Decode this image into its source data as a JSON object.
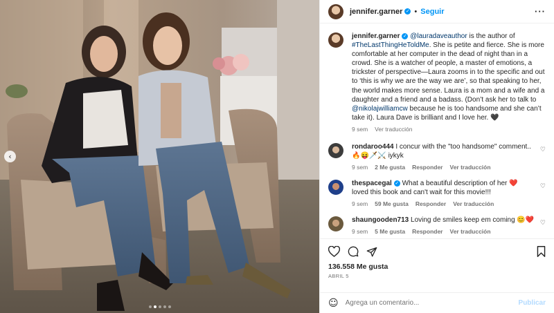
{
  "header": {
    "username": "jennifer.garner",
    "separator": "•",
    "follow_label": "Seguir",
    "more_icon": "more-horizontal-icon"
  },
  "caption": {
    "username": "jennifer.garner",
    "mention": "@lauradaveauthor",
    "text1": " is the author of ",
    "hashtag": "#TheLastThingHeToldMe",
    "text2": ". She is petite and fierce. She is more comfortable at her computer in the dead of night than in a crowd. She is a watcher of people, a master of emotions, a trickster of perspective—Laura zooms in to the specific and out to ‘this is why we are the way we are’, so that speaking to her, the world makes more sense. Laura is a mom and a wife and a daughter and a friend and a badass. (Don’t ask her to talk to ",
    "mention2": "@nikolajwilliamcw",
    "text3": " because he is too handsome and she can’t take it). Laura Dave is brilliant and I love her. 🖤",
    "time": "9 sem",
    "translate": "Ver traducción"
  },
  "comments": [
    {
      "username": "rondaroo444",
      "text": " I concur with the \"too handsome\" comment.. 🔥😝🗡️⚔️ iykyk",
      "time": "9 sem",
      "likes": "2 Me gusta",
      "reply": "Responder",
      "translate": "Ver traducción"
    },
    {
      "username": "thespacegal",
      "text": " What a beautiful description of her ❤️ loved this book and can't wait for this movie!!!",
      "time": "9 sem",
      "likes": "59 Me gusta",
      "reply": "Responder",
      "translate": "Ver traducción"
    },
    {
      "username": "shaungooden713",
      "text": " Loving de smiles keep em coming 😊❤️",
      "time": "9 sem",
      "likes": "5 Me gusta",
      "reply": "Responder",
      "translate": "Ver traducción"
    }
  ],
  "post": {
    "likes": "136.558 Me gusta",
    "date": "ABRIL 5",
    "carousel_index": 2,
    "carousel_count": 5
  },
  "composer": {
    "placeholder": "Agrega un comentario...",
    "post_label": "Publicar"
  },
  "icons": {
    "like": "heart-icon",
    "comment": "comment-icon",
    "share": "share-icon",
    "save": "bookmark-icon",
    "emoji": "emoji-icon",
    "prev": "chevron-left-icon"
  },
  "colors": {
    "accent": "#0095f6",
    "link": "#00376b",
    "muted": "#737373"
  }
}
